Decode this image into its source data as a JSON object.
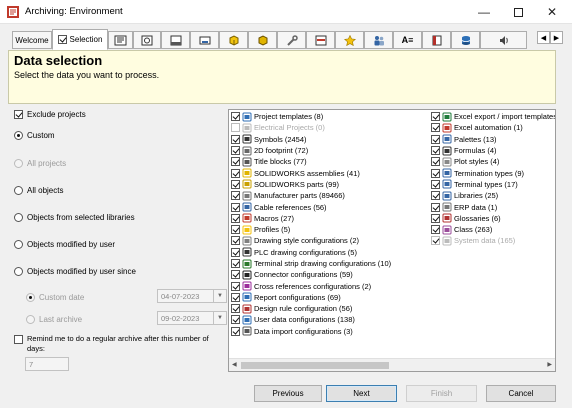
{
  "window": {
    "title": "Archiving: Environment"
  },
  "tabs": [
    {
      "label": "Welcome",
      "icon": "none"
    },
    {
      "label": "Selection",
      "icon": "checkbox-icon"
    },
    {
      "label": "",
      "icon": "project-templates-icon"
    },
    {
      "label": "",
      "icon": "symbols-icon"
    },
    {
      "label": "",
      "icon": "title-blocks-icon"
    },
    {
      "label": "",
      "icon": "cable-references-icon"
    },
    {
      "label": "",
      "icon": "solidworks-assemblies-icon"
    },
    {
      "label": "",
      "icon": "solidworks-parts-icon"
    },
    {
      "label": "",
      "icon": "manufacturer-parts-icon"
    },
    {
      "label": "",
      "icon": "macros-icon"
    },
    {
      "label": "",
      "icon": "profiles-icon"
    },
    {
      "label": "",
      "icon": "users-icon"
    },
    {
      "label": "",
      "icon": "fonts-icon"
    },
    {
      "label": "",
      "icon": "database-icon"
    },
    {
      "label": "",
      "icon": "cylinder-icon"
    },
    {
      "label": "",
      "icon": "speaker-icon"
    }
  ],
  "header": {
    "title": "Data selection",
    "subtitle": "Select the data you want to process."
  },
  "options": {
    "exclude_projects": "Exclude projects",
    "custom": "Custom",
    "all_projects": "All projects",
    "all_objects": "All objects",
    "objects_from_libraries": "Objects from selected libraries",
    "objects_modified_by_user": "Objects modified by user",
    "objects_modified_since": "Objects modified by user since",
    "custom_date": "Custom date",
    "custom_date_value": "04-07-2023",
    "last_archive": "Last archive",
    "last_archive_value": "09-02-2023",
    "remind_label_1": "Remind me to do a regular archive after this number of",
    "remind_label_2": "days:",
    "remind_days": "7"
  },
  "list_col1": [
    {
      "label": "Project templates (8)",
      "checked": true,
      "disabled": false,
      "icon": "project-templates-icon"
    },
    {
      "label": "Electrical Projects (0)",
      "checked": false,
      "disabled": true,
      "icon": "electrical-projects-icon"
    },
    {
      "label": "Symbols (2454)",
      "checked": true,
      "disabled": false,
      "icon": "symbols-icon"
    },
    {
      "label": "2D footprint (72)",
      "checked": true,
      "disabled": false,
      "icon": "footprint-icon"
    },
    {
      "label": "Title blocks (77)",
      "checked": true,
      "disabled": false,
      "icon": "title-blocks-icon"
    },
    {
      "label": "SOLIDWORKS assemblies (41)",
      "checked": true,
      "disabled": false,
      "icon": "solidworks-assemblies-icon"
    },
    {
      "label": "SOLIDWORKS parts (99)",
      "checked": true,
      "disabled": false,
      "icon": "solidworks-parts-icon"
    },
    {
      "label": "Manufacturer parts (89466)",
      "checked": true,
      "disabled": false,
      "icon": "manufacturer-parts-icon"
    },
    {
      "label": "Cable references (56)",
      "checked": true,
      "disabled": false,
      "icon": "cable-references-icon"
    },
    {
      "label": "Macros (27)",
      "checked": true,
      "disabled": false,
      "icon": "macros-icon"
    },
    {
      "label": "Profiles (5)",
      "checked": true,
      "disabled": false,
      "icon": "profiles-icon"
    },
    {
      "label": "Drawing style configurations (2)",
      "checked": true,
      "disabled": false,
      "icon": "drawing-style-icon"
    },
    {
      "label": "PLC drawing configurations (5)",
      "checked": true,
      "disabled": false,
      "icon": "plc-icon"
    },
    {
      "label": "Terminal strip drawing configurations (10)",
      "checked": true,
      "disabled": false,
      "icon": "terminal-strip-icon"
    },
    {
      "label": "Connector configurations (59)",
      "checked": true,
      "disabled": false,
      "icon": "connector-icon"
    },
    {
      "label": "Cross references configurations (2)",
      "checked": true,
      "disabled": false,
      "icon": "cross-references-icon"
    },
    {
      "label": "Report configurations (69)",
      "checked": true,
      "disabled": false,
      "icon": "report-icon"
    },
    {
      "label": "Design rule configuration (56)",
      "checked": true,
      "disabled": false,
      "icon": "design-rule-icon"
    },
    {
      "label": "User data configurations (138)",
      "checked": true,
      "disabled": false,
      "icon": "user-data-icon"
    },
    {
      "label": "Data import configurations (3)",
      "checked": true,
      "disabled": false,
      "icon": "data-import-icon"
    }
  ],
  "list_col2": [
    {
      "label": "Excel export / import templates",
      "checked": true,
      "disabled": false,
      "icon": "excel-export-icon"
    },
    {
      "label": "Excel automation (1)",
      "checked": true,
      "disabled": false,
      "icon": "excel-automation-icon"
    },
    {
      "label": "Palettes (13)",
      "checked": true,
      "disabled": false,
      "icon": "palettes-icon"
    },
    {
      "label": "Formulas (4)",
      "checked": true,
      "disabled": false,
      "icon": "formulas-icon"
    },
    {
      "label": "Plot styles (4)",
      "checked": true,
      "disabled": false,
      "icon": "plot-styles-icon"
    },
    {
      "label": "Termination types (9)",
      "checked": true,
      "disabled": false,
      "icon": "termination-types-icon"
    },
    {
      "label": "Terminal types (17)",
      "checked": true,
      "disabled": false,
      "icon": "terminal-types-icon"
    },
    {
      "label": "Libraries (25)",
      "checked": true,
      "disabled": false,
      "icon": "libraries-icon"
    },
    {
      "label": "ERP data (1)",
      "checked": true,
      "disabled": false,
      "icon": "erp-data-icon"
    },
    {
      "label": "Glossaries (6)",
      "checked": true,
      "disabled": false,
      "icon": "glossaries-icon"
    },
    {
      "label": "Class (263)",
      "checked": true,
      "disabled": false,
      "icon": "class-icon"
    },
    {
      "label": "System data (165)",
      "checked": true,
      "disabled": true,
      "icon": "system-data-icon"
    }
  ],
  "buttons": {
    "previous": "Previous",
    "next": "Next",
    "finish": "Finish",
    "cancel": "Cancel"
  }
}
